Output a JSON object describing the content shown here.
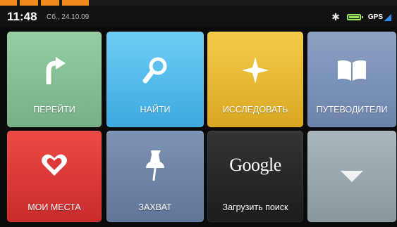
{
  "status": {
    "time": "11:48",
    "date": "Сб., 24.10.09",
    "gps_label": "GPS",
    "icons": [
      "bluetooth-icon",
      "battery-icon",
      "gps-signal-icon"
    ],
    "battery_color": "#9be35a"
  },
  "tiles": [
    {
      "id": "go",
      "label": "ПЕРЕЙТИ",
      "icon": "turn-arrow-icon",
      "color": "#86c095"
    },
    {
      "id": "find",
      "label": "НАЙТИ",
      "icon": "magnifier-icon",
      "color": "#52b8e8"
    },
    {
      "id": "explore",
      "label": "ИССЛЕДОВАТЬ",
      "icon": "compass-star-icon",
      "color": "#e7b834"
    },
    {
      "id": "guides",
      "label": "ПУТЕВОДИТЕЛИ",
      "icon": "open-book-icon",
      "color": "#7b93b8"
    },
    {
      "id": "places",
      "label": "МОИ МЕСТА",
      "icon": "heart-icon",
      "color": "#dd3a37"
    },
    {
      "id": "capture",
      "label": "ЗАХВАТ",
      "icon": "pushpin-icon",
      "color": "#6d84a7"
    },
    {
      "id": "google",
      "label": "Загрузить поиск",
      "icon": "google-logo",
      "logo_text": "Google",
      "color": "#262626"
    },
    {
      "id": "more",
      "label": "",
      "icon": "down-arrow-icon",
      "color": "#99a7ad"
    }
  ]
}
